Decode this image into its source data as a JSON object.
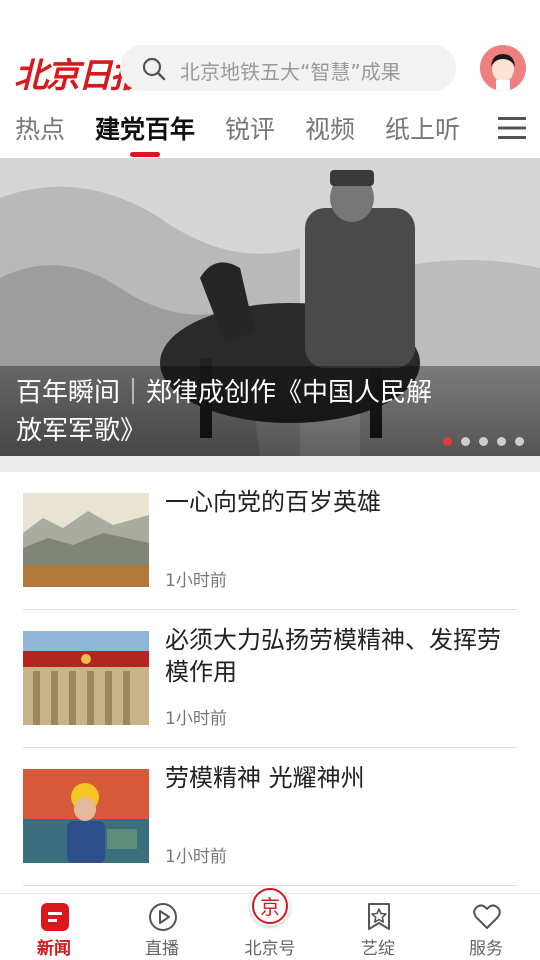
{
  "header": {
    "logo_text": "北京日报",
    "search_placeholder": "北京地铁五大“智慧”成果"
  },
  "tabs": [
    {
      "label": "热点",
      "active": false
    },
    {
      "label": "建党百年",
      "active": true
    },
    {
      "label": "锐评",
      "active": false
    },
    {
      "label": "视频",
      "active": false
    },
    {
      "label": "纸上听",
      "active": false
    }
  ],
  "hero": {
    "title": "百年瞬间｜郑律成创作《中国人民解放军军歌》",
    "slide_count": 5,
    "active_slide": 1
  },
  "news": [
    {
      "title": "一心向党的百岁英雄",
      "time": "1小时前"
    },
    {
      "title": "必须大力弘扬劳模精神、发挥劳模作用",
      "time": "1小时前"
    },
    {
      "title": "劳模精神  光耀神州",
      "time": "1小时前"
    }
  ],
  "bottom_nav": [
    {
      "label": "新闻",
      "icon": "news-icon",
      "active": true
    },
    {
      "label": "直播",
      "icon": "play-icon",
      "active": false
    },
    {
      "label": "北京号",
      "icon": "beijing-badge-icon",
      "active": false
    },
    {
      "label": "艺绽",
      "icon": "star-bookmark-icon",
      "active": false
    },
    {
      "label": "服务",
      "icon": "heart-icon",
      "active": false
    }
  ],
  "colors": {
    "brand_red": "#d7191d",
    "inactive_text": "#777777",
    "search_bg": "#f2f2f2"
  }
}
